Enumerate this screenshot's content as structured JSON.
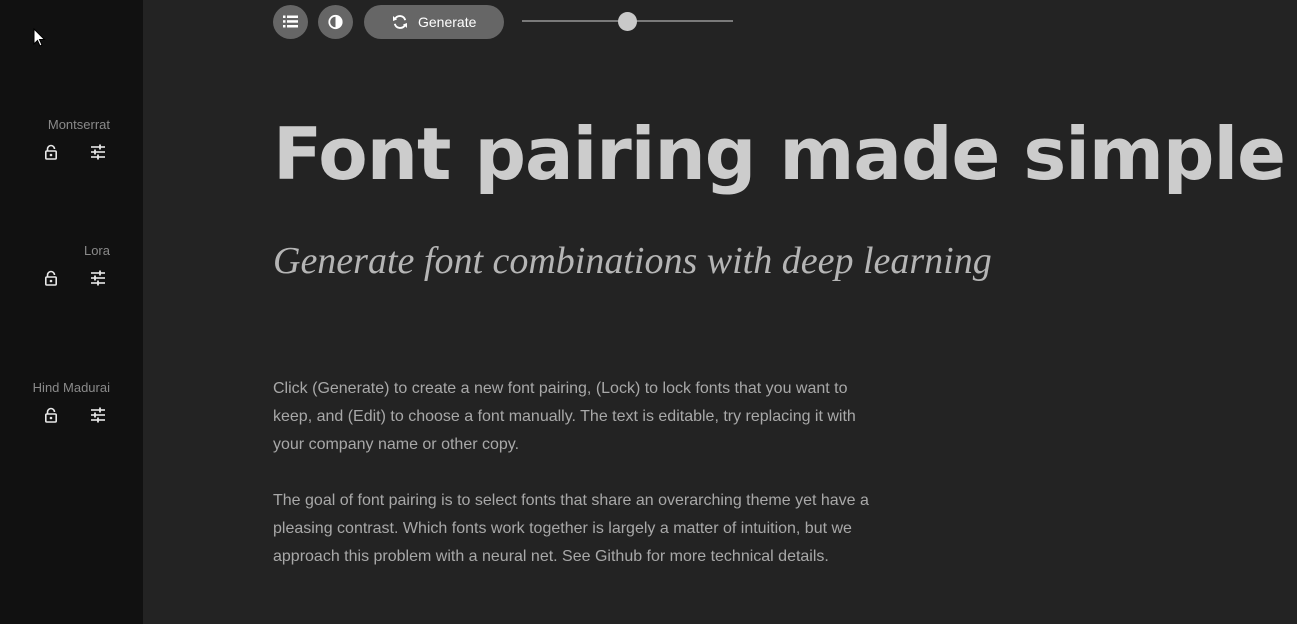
{
  "sidebar": {
    "fonts": [
      {
        "name": "Montserrat",
        "lock_icon": "lock-icon",
        "edit_icon": "sliders-icon"
      },
      {
        "name": "Lora",
        "lock_icon": "lock-icon",
        "edit_icon": "sliders-icon"
      },
      {
        "name": "Hind Madurai",
        "lock_icon": "lock-icon",
        "edit_icon": "sliders-icon"
      }
    ]
  },
  "toolbar": {
    "list_icon": "list-icon",
    "contrast_icon": "contrast-icon",
    "generate_icon": "refresh-icon",
    "generate_label": "Generate",
    "slider_value": 0.5
  },
  "content": {
    "headline": "Font pairing made simple",
    "subhead": "Generate font combinations with deep learning",
    "paragraph1": "Click (Generate) to create a new font pairing, (Lock) to lock fonts that you want to keep, and (Edit) to choose a font manually. The text is editable, try replacing it with your company name or other copy.",
    "paragraph2": "The goal of font pairing is to select fonts that share an overarching theme yet have a pleasing contrast. Which fonts work together is largely a matter of intuition, but we approach this problem with a neural net. See Github for more technical details."
  },
  "colors": {
    "background": "#232323",
    "sidebar": "#111111",
    "button": "#666666",
    "headline": "#cccccc"
  }
}
